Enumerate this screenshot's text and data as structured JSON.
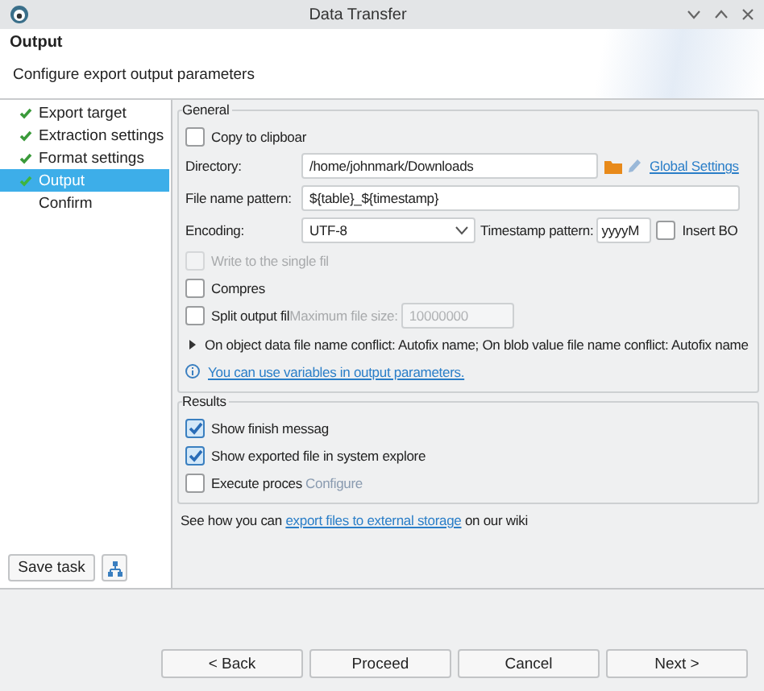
{
  "window": {
    "title": "Data Transfer"
  },
  "header": {
    "title": "Output",
    "description": "Configure export output parameters"
  },
  "sidebar": {
    "items": [
      {
        "label": "Export target",
        "done": true,
        "selected": false
      },
      {
        "label": "Extraction settings",
        "done": true,
        "selected": false
      },
      {
        "label": "Format settings",
        "done": true,
        "selected": false
      },
      {
        "label": "Output",
        "done": true,
        "selected": true
      },
      {
        "label": "Confirm",
        "done": false,
        "selected": false
      }
    ],
    "save_button": "Save task"
  },
  "general": {
    "title": "General",
    "rows": [
      {
        "kind": "checkbox",
        "label": "Copy to clipboar",
        "checked": false,
        "disabled": false
      },
      {
        "kind": "directory",
        "label": "Directory:",
        "value": "/home/johnmark/Downloads",
        "link": "Global Settings"
      },
      {
        "kind": "text",
        "label": "File name pattern:",
        "value": "${table}_${timestamp}"
      },
      {
        "kind": "encoding",
        "label": "Encoding:",
        "value": "UTF-8",
        "timestamp_label": "Timestamp pattern:",
        "timestamp_value": "yyyyM",
        "bom_label": "Insert BO",
        "bom_checked": false
      },
      {
        "kind": "checkbox",
        "label": "Write to the single fil",
        "checked": false,
        "disabled": true
      },
      {
        "kind": "checkbox",
        "label": "Compres",
        "checked": false,
        "disabled": false
      },
      {
        "kind": "split",
        "label": "Split output fil",
        "checked": false,
        "size_label": "Maximum file size:",
        "size_value": "10000000",
        "size_disabled": true
      },
      {
        "kind": "expander",
        "label": "On object data file name conflict: Autofix name; On blob value file name conflict: Autofix name",
        "expanded": false
      },
      {
        "kind": "info",
        "link": "You can use variables in output parameters."
      }
    ]
  },
  "results": {
    "title": "Results",
    "rows": [
      {
        "label": "Show finish messag",
        "checked": true
      },
      {
        "label": "Show exported file in system explore",
        "checked": true
      },
      {
        "label": "Execute proces",
        "checked": false,
        "link": "Configure",
        "link_disabled": true
      }
    ]
  },
  "wiki_hint": {
    "before": "See how you can ",
    "link": "export files to external storage",
    "after": " on our wiki"
  },
  "buttons": [
    {
      "label": "< Back"
    },
    {
      "label": "Proceed"
    },
    {
      "label": "Cancel"
    },
    {
      "label": "Next >"
    }
  ]
}
